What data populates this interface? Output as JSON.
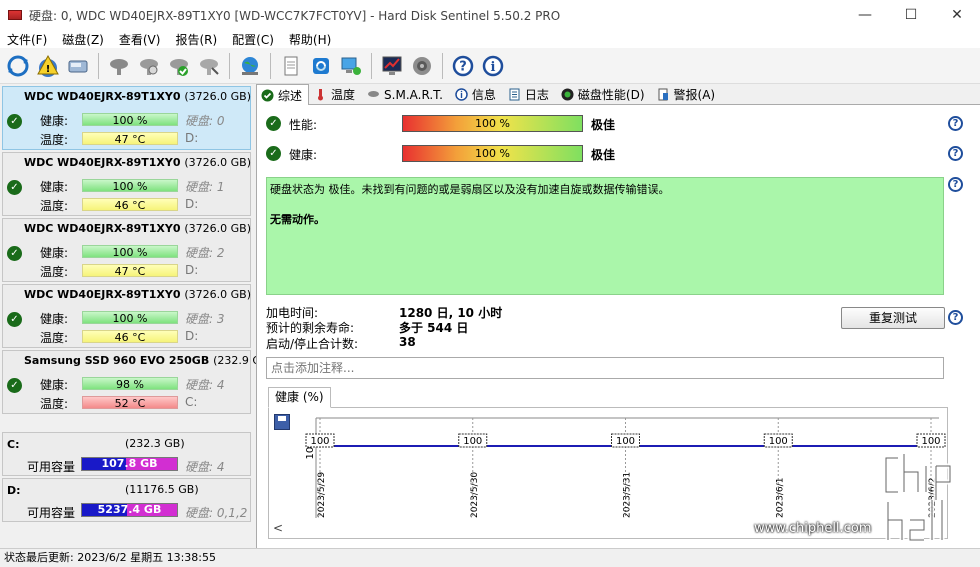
{
  "window": {
    "title": "硬盘:   0, WDC WD40EJRX-89T1XY0 [WD-WCC7K7FCT0YV]  -  Hard Disk Sentinel 5.50.2 PRO",
    "minimize": "—",
    "maximize": "☐",
    "close": "✕"
  },
  "menu": [
    "文件(F)",
    "磁盘(Z)",
    "查看(V)",
    "报告(R)",
    "配置(C)",
    "帮助(H)"
  ],
  "toolbar_icons": [
    "refresh-icon",
    "alert-icon",
    "disk-icon",
    "disk-gray-icon",
    "disk-test-icon",
    "disk-check-icon",
    "disk-scan-icon",
    "globe-icon",
    "document-icon",
    "network-refresh-icon",
    "computer-icon",
    "monitor-graph-icon",
    "speaker-icon",
    "help-icon",
    "info-icon"
  ],
  "disks": [
    {
      "name": "WDC WD40EJRX-89T1XY0",
      "capacity": "(3726.0 GB)",
      "health_label": "健康:",
      "health": "100 %",
      "temp_label": "温度:",
      "temp": "47 °C",
      "disk_no": "硬盘: 0",
      "drive": "D:",
      "temp_color": "yellow"
    },
    {
      "name": "WDC WD40EJRX-89T1XY0",
      "capacity": "(3726.0 GB)",
      "health_label": "健康:",
      "health": "100 %",
      "temp_label": "温度:",
      "temp": "46 °C",
      "disk_no": "硬盘: 1",
      "drive": "D:",
      "temp_color": "yellow"
    },
    {
      "name": "WDC WD40EJRX-89T1XY0",
      "capacity": "(3726.0 GB)",
      "health_label": "健康:",
      "health": "100 %",
      "temp_label": "温度:",
      "temp": "47 °C",
      "disk_no": "硬盘: 2",
      "drive": "D:",
      "temp_color": "yellow"
    },
    {
      "name": "WDC WD40EJRX-89T1XY0",
      "capacity": "(3726.0 GB)",
      "health_label": "健康:",
      "health": "100 %",
      "temp_label": "温度:",
      "temp": "46 °C",
      "disk_no": "硬盘: 3",
      "drive": "D:",
      "temp_color": "yellow"
    },
    {
      "name": "Samsung SSD 960 EVO 250GB",
      "capacity": "(232.9 GB)",
      "health_label": "健康:",
      "health": "98 %",
      "temp_label": "温度:",
      "temp": "52 °C",
      "disk_no": "硬盘: 4",
      "drive": "C:",
      "temp_color": "red"
    }
  ],
  "volumes": [
    {
      "letter": "C:",
      "size": "(232.3 GB)",
      "free_label": "可用容量",
      "free": "107.8 GB",
      "free_fraction": 0.46,
      "disk_no": "硬盘: 4"
    },
    {
      "letter": "D:",
      "size": "(11176.5 GB)",
      "free_label": "可用容量",
      "free": "5237.4 GB",
      "free_fraction": 0.47,
      "disk_no": "硬盘: 0,1,2"
    }
  ],
  "status_bar": "状态最后更新:   2023/6/2 星期五 13:38:55",
  "tabs": [
    {
      "label": "综述",
      "icon": "check-icon"
    },
    {
      "label": "温度",
      "icon": "thermometer-icon"
    },
    {
      "label": "S.M.A.R.T.",
      "icon": "smart-icon"
    },
    {
      "label": "信息",
      "icon": "info-icon"
    },
    {
      "label": "日志",
      "icon": "log-icon"
    },
    {
      "label": "磁盘性能(D)",
      "icon": "performance-icon"
    },
    {
      "label": "警报(A)",
      "icon": "alert-doc-icon"
    }
  ],
  "overview": {
    "performance_label": "性能:",
    "performance_value": "100 %",
    "performance_rating": "极佳",
    "health_label": "健康:",
    "health_value": "100 %",
    "health_rating": "极佳",
    "summary_line": "硬盘状态为 极佳。未找到有问题的或是弱扇区以及没有加速自旋或数据传输错误。",
    "action_line": "无需动作。",
    "power_on_label": "加电时间:",
    "power_on_value": "1280 日, 10 小时",
    "remaining_label": "预计的剩余寿命:",
    "remaining_value": "多于 544 日",
    "start_stop_label": "启动/停止合计数:",
    "start_stop_value": "38",
    "retest_button": "重复测试",
    "note_placeholder": "点击添加注释...",
    "help_glyph": "?"
  },
  "health_graph": {
    "tab_label": "健康 (%)",
    "y_tick": "100",
    "scroll_left": "<",
    "chart_data": {
      "type": "line",
      "x": [
        "2023/5/29",
        "2023/5/30",
        "2023/5/31",
        "2023/6/1",
        "2023/6/2"
      ],
      "values": [
        100,
        100,
        100,
        100,
        100
      ],
      "data_labels": [
        "100",
        "100",
        "100",
        "100",
        "100"
      ],
      "color": "#1c1cb4"
    }
  },
  "watermark": "www.chiphell.com",
  "logo_text": "chip hell"
}
